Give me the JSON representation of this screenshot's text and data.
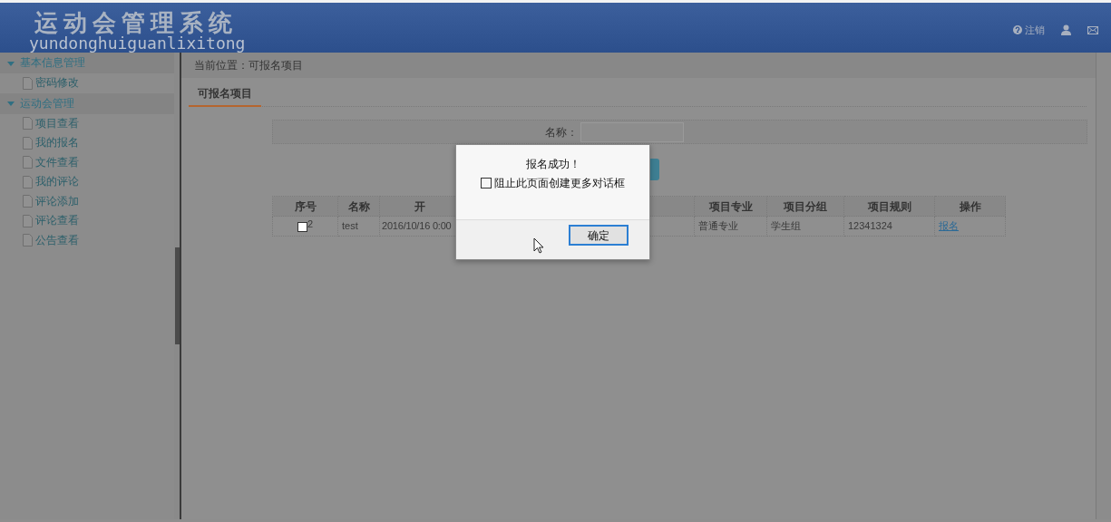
{
  "header": {
    "title": "运动会管理系统",
    "subtitle": "yundonghuiguanlixitong",
    "logout": "注销"
  },
  "sidebar": {
    "groups": [
      {
        "label": "基本信息管理",
        "expanded": true,
        "items": [
          "密码修改"
        ]
      },
      {
        "label": "运动会管理",
        "expanded": true,
        "items": [
          "项目查看",
          "我的报名",
          "文件查看",
          "我的评论",
          "评论添加",
          "评论查看",
          "公告查看"
        ]
      }
    ]
  },
  "breadcrumb": "当前位置：可报名项目",
  "tabs": [
    {
      "label": "可报名项目",
      "selected": true
    }
  ],
  "search": {
    "label": "名称："
  },
  "table": {
    "columns": [
      "序号",
      "名称",
      "开",
      "项目专业",
      "项目分组",
      "项目规则",
      "操作"
    ],
    "rows": [
      {
        "checked": false,
        "cells": [
          "2",
          "test",
          "2016/10/16 0:00",
          "普通专业",
          "学生组",
          "12341324"
        ],
        "action": "报名"
      }
    ]
  },
  "dialog": {
    "message": "报名成功！",
    "option": {
      "label": "阻止此页面创建更多对话框",
      "checked": false
    },
    "button": "确定"
  }
}
